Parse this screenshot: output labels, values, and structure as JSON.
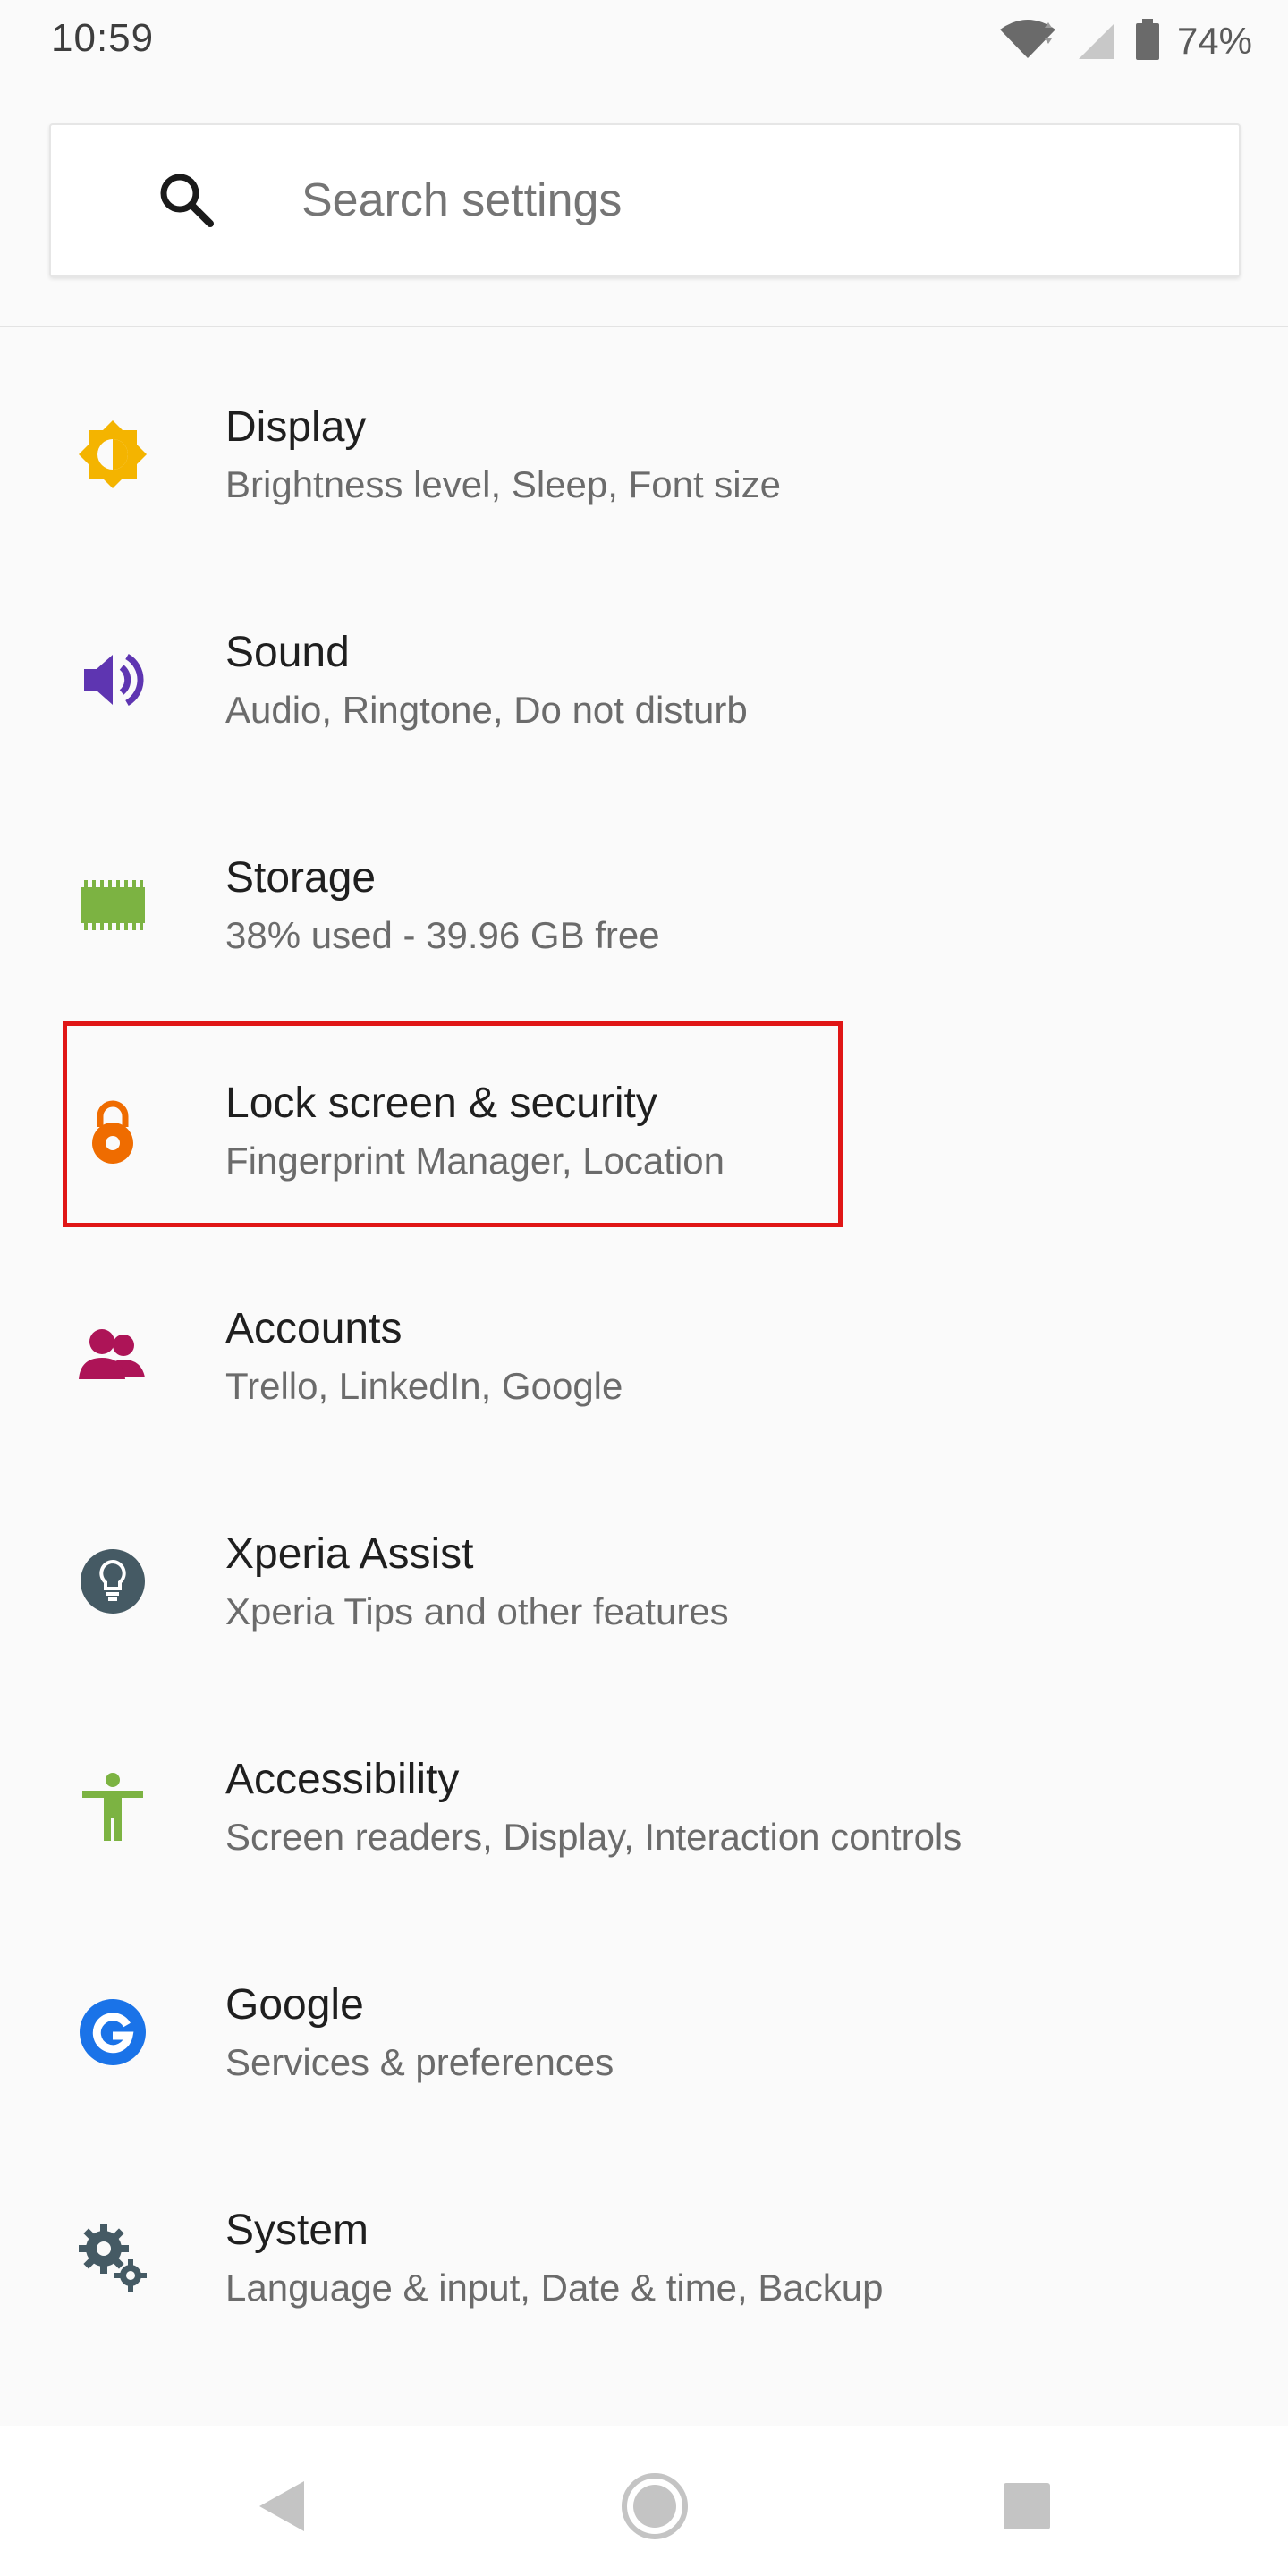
{
  "status_bar": {
    "time": "10:59",
    "battery_percent": "74%",
    "icons": [
      "wifi-icon",
      "cell-signal-icon",
      "battery-icon"
    ]
  },
  "search": {
    "placeholder": "Search settings"
  },
  "settings": {
    "items": [
      {
        "title": "Display",
        "subtitle": "Brightness level, Sleep, Font size",
        "icon": "brightness-icon",
        "color": "#f4b400"
      },
      {
        "title": "Sound",
        "subtitle": "Audio, Ringtone, Do not disturb",
        "icon": "volume-icon",
        "color": "#5e35b1"
      },
      {
        "title": "Storage",
        "subtitle": "38% used - 39.96 GB free",
        "icon": "storage-chip-icon",
        "color": "#7cb342"
      },
      {
        "title": "Lock screen & security",
        "subtitle": "Fingerprint Manager, Location",
        "icon": "lock-icon",
        "color": "#ef6c00"
      },
      {
        "title": "Accounts",
        "subtitle": "Trello, LinkedIn, Google",
        "icon": "accounts-icon",
        "color": "#ad1457"
      },
      {
        "title": "Xperia Assist",
        "subtitle": "Xperia Tips and other features",
        "icon": "lightbulb-icon",
        "color": "#455a64"
      },
      {
        "title": "Accessibility",
        "subtitle": "Screen readers, Display, Interaction controls",
        "icon": "accessibility-icon",
        "color": "#7cb342"
      },
      {
        "title": "Google",
        "subtitle": "Services & preferences",
        "icon": "google-icon",
        "color": "#1a73e8"
      },
      {
        "title": "System",
        "subtitle": "Language & input, Date & time, Backup",
        "icon": "gears-icon",
        "color": "#455a64"
      }
    ]
  },
  "highlight": {
    "target": "Lock screen & security",
    "color": "#e01616"
  },
  "nav_bar": {
    "buttons": [
      "back-icon",
      "home-icon",
      "recents-icon"
    ]
  }
}
